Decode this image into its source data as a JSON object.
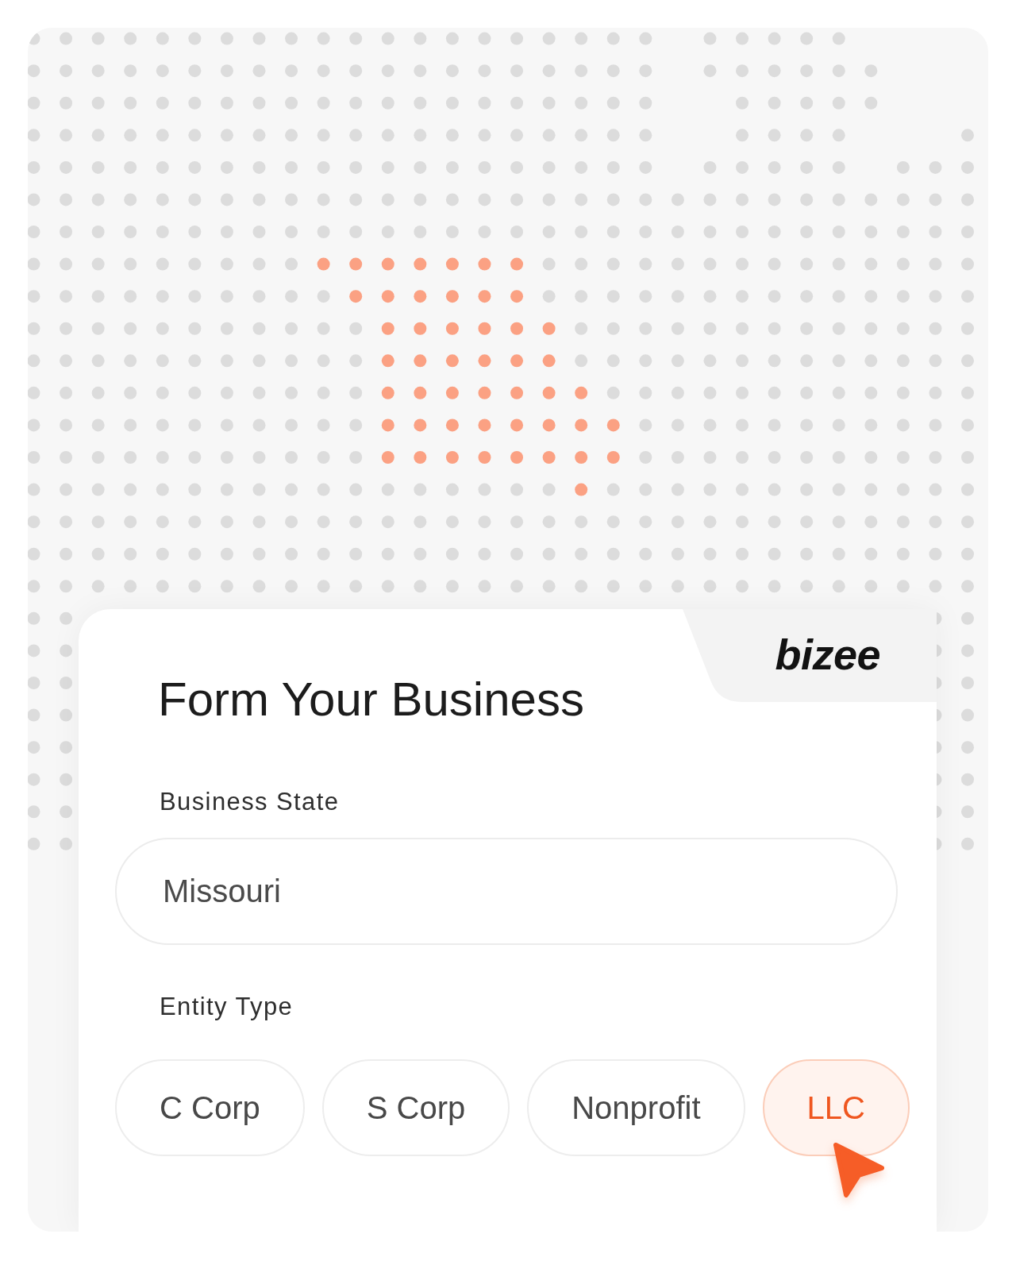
{
  "logo": "bizee",
  "title": "Form Your Business",
  "state_field": {
    "label": "Business State",
    "value": "Missouri"
  },
  "entity_type": {
    "label": "Entity Type",
    "options": [
      {
        "label": "C Corp",
        "selected": false
      },
      {
        "label": "S Corp",
        "selected": false
      },
      {
        "label": "Nonprofit",
        "selected": false
      },
      {
        "label": "LLC",
        "selected": true
      }
    ]
  }
}
